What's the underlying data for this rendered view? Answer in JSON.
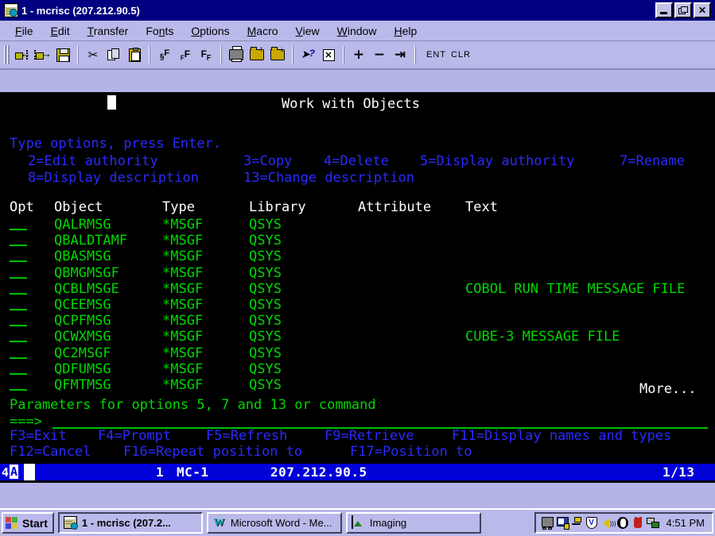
{
  "window": {
    "title": "1 - mcrisc (207.212.90.5)",
    "icon": "terminal-session-icon",
    "buttons": {
      "minimize": "minimize-icon",
      "restore": "restore-icon",
      "close": "close-icon"
    }
  },
  "menubar": {
    "items": [
      {
        "label": "File",
        "accel": "F"
      },
      {
        "label": "Edit",
        "accel": "E"
      },
      {
        "label": "Transfer",
        "accel": "T"
      },
      {
        "label": "Fonts",
        "accel": "n"
      },
      {
        "label": "Options",
        "accel": "O"
      },
      {
        "label": "Macro",
        "accel": "M"
      },
      {
        "label": "View",
        "accel": "V"
      },
      {
        "label": "Window",
        "accel": "W"
      },
      {
        "label": "Help",
        "accel": "H"
      }
    ]
  },
  "toolbar": {
    "buttons": [
      {
        "name": "receive-file-icon"
      },
      {
        "name": "send-file-icon"
      },
      {
        "name": "save-icon"
      },
      {
        "name": "cut-icon"
      },
      {
        "name": "copy-icon"
      },
      {
        "name": "paste-icon"
      },
      {
        "name": "font-size-small-icon",
        "label": "§F"
      },
      {
        "name": "font-size-medium-icon",
        "label": "FF"
      },
      {
        "name": "font-size-large-icon",
        "label": "FF"
      },
      {
        "name": "print-icon"
      },
      {
        "name": "open-folder-up-icon"
      },
      {
        "name": "open-folder-down-icon"
      },
      {
        "name": "context-help-icon"
      },
      {
        "name": "stop-icon"
      },
      {
        "name": "zoom-in-icon",
        "label": "+"
      },
      {
        "name": "zoom-out-icon",
        "label": "−"
      },
      {
        "name": "tab-icon",
        "label": "→|"
      }
    ],
    "ent_label": "ENT",
    "clr_label": "CLR"
  },
  "terminal": {
    "screen_title": "Work with Objects",
    "instruction": "Type options, press Enter.",
    "options_line1": [
      {
        "text": "2=Edit authority"
      },
      {
        "text": "3=Copy"
      },
      {
        "text": "4=Delete"
      },
      {
        "text": "5=Display authority"
      },
      {
        "text": "7=Rename"
      }
    ],
    "options_line2": [
      {
        "text": "8=Display description"
      },
      {
        "text": "13=Change description"
      }
    ],
    "columns": [
      "Opt",
      "Object",
      "Type",
      "Library",
      "Attribute",
      "Text"
    ],
    "rows": [
      {
        "opt": "",
        "object": "QALRMSG",
        "type": "*MSGF",
        "library": "QSYS",
        "attribute": "",
        "text": ""
      },
      {
        "opt": "",
        "object": "QBALDTAMF",
        "type": "*MSGF",
        "library": "QSYS",
        "attribute": "",
        "text": ""
      },
      {
        "opt": "",
        "object": "QBASMSG",
        "type": "*MSGF",
        "library": "QSYS",
        "attribute": "",
        "text": ""
      },
      {
        "opt": "",
        "object": "QBMGMSGF",
        "type": "*MSGF",
        "library": "QSYS",
        "attribute": "",
        "text": ""
      },
      {
        "opt": "",
        "object": "QCBLMSGE",
        "type": "*MSGF",
        "library": "QSYS",
        "attribute": "",
        "text": "COBOL RUN TIME MESSAGE FILE"
      },
      {
        "opt": "",
        "object": "QCEEMSG",
        "type": "*MSGF",
        "library": "QSYS",
        "attribute": "",
        "text": ""
      },
      {
        "opt": "",
        "object": "QCPFMSG",
        "type": "*MSGF",
        "library": "QSYS",
        "attribute": "",
        "text": ""
      },
      {
        "opt": "",
        "object": "QCWXMSG",
        "type": "*MSGF",
        "library": "QSYS",
        "attribute": "",
        "text": "CUBE-3 MESSAGE FILE"
      },
      {
        "opt": "",
        "object": "QC2MSGF",
        "type": "*MSGF",
        "library": "QSYS",
        "attribute": "",
        "text": ""
      },
      {
        "opt": "",
        "object": "QDFUMSG",
        "type": "*MSGF",
        "library": "QSYS",
        "attribute": "",
        "text": ""
      },
      {
        "opt": "",
        "object": "QFMTMSG",
        "type": "*MSGF",
        "library": "QSYS",
        "attribute": "",
        "text": ""
      }
    ],
    "more_indicator": "More...",
    "parameters_label": "Parameters for options 5, 7 and 13 or command",
    "command_prompt": "===>",
    "command_value": "",
    "fkeys_line1": [
      "F3=Exit",
      "F4=Prompt",
      "F5=Refresh",
      "F9=Retrieve",
      "F11=Display names and types"
    ],
    "fkeys_line2": [
      "F12=Cancel",
      "F16=Repeat position to",
      "F17=Position to"
    ]
  },
  "oia": {
    "shift_indicator": "4",
    "input_mode": "A",
    "session_id": "1",
    "system_name": "MC-1",
    "host_address": "207.212.90.5",
    "cursor_position": "1/13"
  },
  "taskbar": {
    "start_label": "Start",
    "items": [
      {
        "label": "1 - mcrisc (207.2...",
        "icon": "terminal-session-icon",
        "active": true
      },
      {
        "label": "Microsoft Word - Me...",
        "icon": "word-icon",
        "active": false
      },
      {
        "label": "Imaging",
        "icon": "imaging-icon",
        "active": false
      }
    ],
    "tray": [
      {
        "name": "display-properties-icon"
      },
      {
        "name": "network-monitor-icon"
      },
      {
        "name": "power-plug-icon"
      },
      {
        "name": "antivirus-shield-icon"
      },
      {
        "name": "volume-speaker-icon"
      },
      {
        "name": "eudora-icon"
      },
      {
        "name": "devil-icon"
      },
      {
        "name": "network-connection-icon"
      }
    ],
    "clock": "4:51 PM"
  },
  "colors": {
    "terminal_bg": "#000000",
    "terminal_green": "#00d800",
    "terminal_blue": "#2a2aff",
    "terminal_white": "#ffffff",
    "titlebar": "#000080",
    "chrome": "#b9b9ea",
    "oia_blue": "#0000d8"
  }
}
